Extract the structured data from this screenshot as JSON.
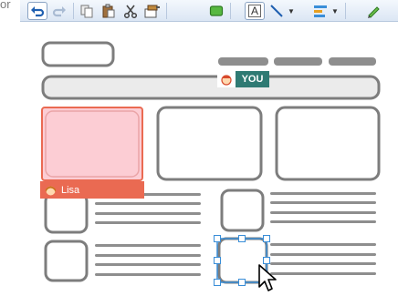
{
  "corner_text": "or",
  "toolbar": {
    "buttons": [
      {
        "name": "undo-button",
        "icon": "undo-icon"
      },
      {
        "name": "redo-button",
        "icon": "redo-icon"
      },
      {
        "name": "copy-button",
        "icon": "copy-icon"
      },
      {
        "name": "paste-button",
        "icon": "paste-icon"
      },
      {
        "name": "cut-button",
        "icon": "scissors-icon"
      },
      {
        "name": "format-painter-button",
        "icon": "paintbrush-icon"
      },
      {
        "name": "rectangle-tool-button",
        "icon": "rounded-rect-icon"
      },
      {
        "name": "text-tool-button",
        "icon": "text-icon",
        "label": "A"
      },
      {
        "name": "line-tool-button",
        "icon": "line-icon"
      },
      {
        "name": "style-button",
        "icon": "style-icon"
      },
      {
        "name": "pencil-tool-button",
        "icon": "pencil-icon"
      }
    ],
    "text_tool_label": "A"
  },
  "collaborators": {
    "you": {
      "label": "YOU",
      "color": "#2f7a73"
    },
    "lisa": {
      "label": "Lisa",
      "color": "#ea6a52"
    }
  },
  "colors": {
    "wire_stroke": "#7d7d7d",
    "wire_fill": "#ffffff",
    "lisa_highlight_fill": "#fccdd4",
    "selection": "#3a8ed8"
  }
}
